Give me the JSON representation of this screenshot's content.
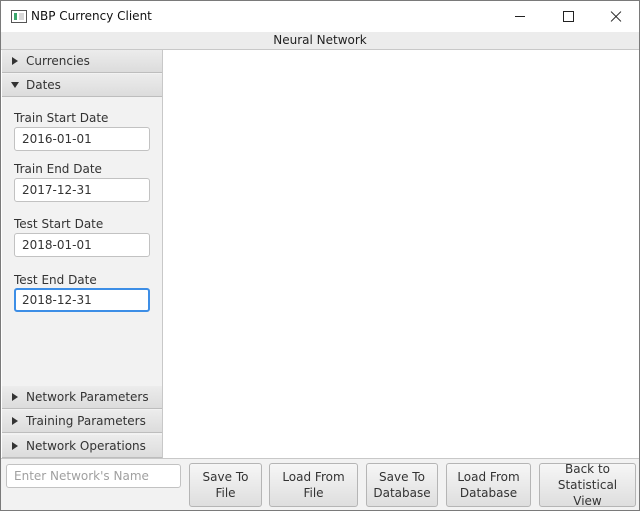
{
  "window": {
    "title": "NBP Currency Client"
  },
  "content_header": {
    "title": "Neural Network"
  },
  "sidebar": {
    "panes": [
      {
        "label": "Currencies",
        "expanded": false
      },
      {
        "label": "Dates",
        "expanded": true
      },
      {
        "label": "Network Parameters",
        "expanded": false
      },
      {
        "label": "Training Parameters",
        "expanded": false
      },
      {
        "label": "Network Operations",
        "expanded": false
      }
    ],
    "dates": {
      "train_start": {
        "label": "Train Start Date",
        "value": "2016-01-01"
      },
      "train_end": {
        "label": "Train End Date",
        "value": "2017-12-31"
      },
      "test_start": {
        "label": "Test Start Date",
        "value": "2018-01-01"
      },
      "test_end": {
        "label": "Test End Date",
        "value": "2018-12-31"
      }
    }
  },
  "bottom_bar": {
    "name_placeholder": "Enter Network's Name",
    "buttons": {
      "save_to_file": "Save To\nFile",
      "load_from_file": "Load From File",
      "save_to_database": "Save To\nDatabase",
      "load_from_database": "Load From\nDatabase",
      "back_to_statistical_view": "Back to\nStatistical View"
    }
  },
  "colors": {
    "focus_accent": "#3d8ee6",
    "sidebar_background": "#f2f2f2"
  }
}
